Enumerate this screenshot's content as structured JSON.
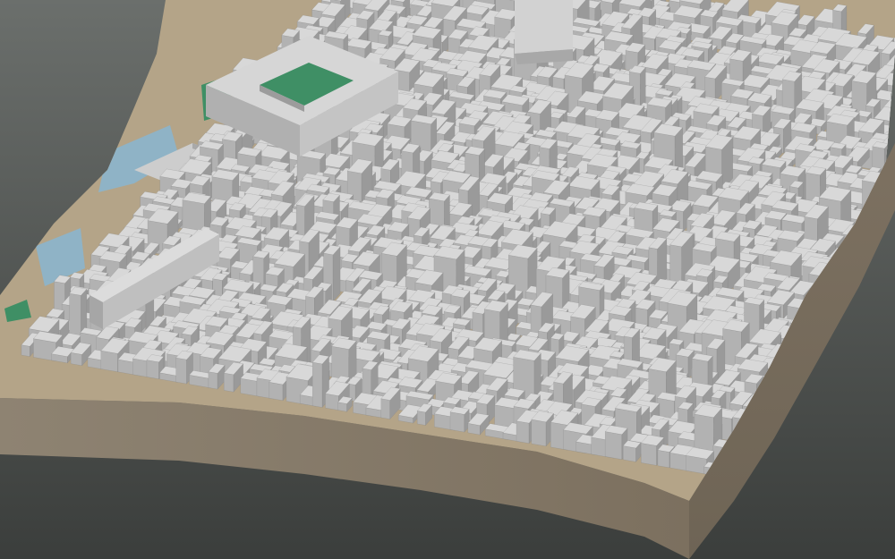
{
  "scene": {
    "subject": "city-block-3d-model",
    "colors": {
      "background_top": "#6a6e6b",
      "background_bottom": "#3a3d3b",
      "base_side": "#8c8070",
      "base_side_dark": "#7a6f60",
      "ground": "#b5a58a",
      "building_top": "#d8d8d8",
      "building_side": "#b2b2b2",
      "building_shadow": "#9a9a9a",
      "park": "#3f8f65",
      "water": "#8fb3c6",
      "plaza": "#cfcfcf"
    }
  }
}
